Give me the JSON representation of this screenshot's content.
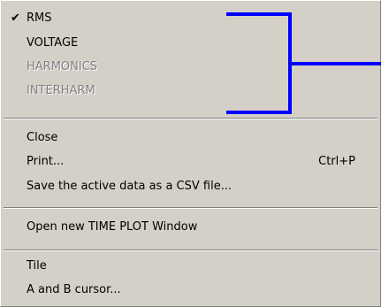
{
  "menu": {
    "items": [
      {
        "label": "RMS",
        "checked": true,
        "enabled": true
      },
      {
        "label": "VOLTAGE",
        "checked": false,
        "enabled": true
      },
      {
        "label": "HARMONICS",
        "checked": false,
        "enabled": false
      },
      {
        "label": "INTERHARM",
        "checked": false,
        "enabled": false
      },
      {
        "label": "Close",
        "enabled": true
      },
      {
        "label": "Print...",
        "shortcut": "Ctrl+P",
        "enabled": true
      },
      {
        "label": "Save the active data as a CSV file...",
        "enabled": true
      },
      {
        "label": "Open new TIME PLOT Window",
        "enabled": true
      },
      {
        "label": "Tile",
        "enabled": true
      },
      {
        "label": "A and B cursor...",
        "enabled": true
      }
    ],
    "check_glyph": "✔"
  },
  "colors": {
    "menu_background": "#d4d0c8",
    "disabled_text": "#808080",
    "annotation_bracket": "#0000ff"
  }
}
